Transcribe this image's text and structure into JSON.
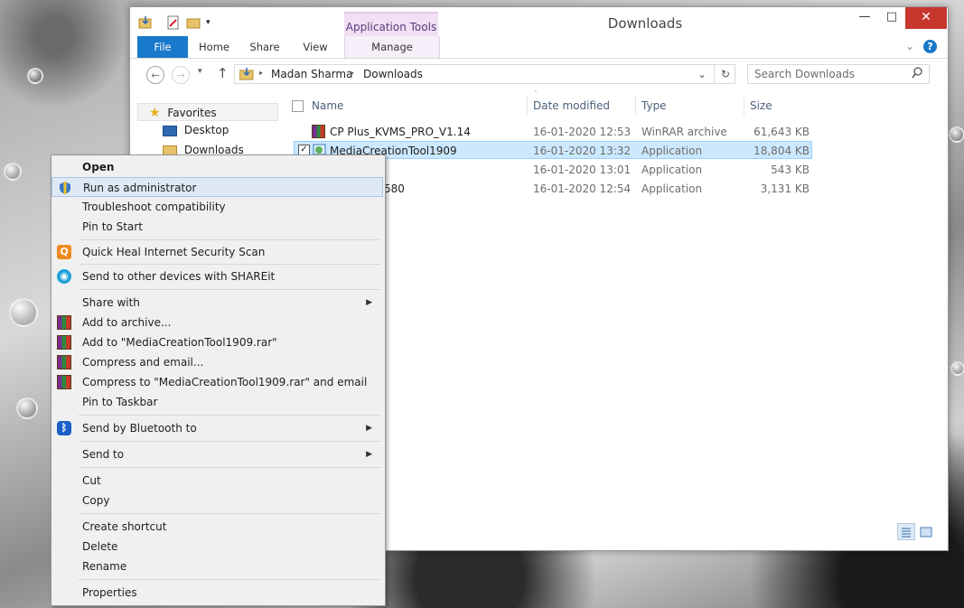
{
  "window": {
    "title": "Downloads",
    "app_tools_label": "Application Tools",
    "minimize": "—",
    "maximize": "□",
    "close": "✕"
  },
  "ribbon": {
    "tabs": [
      "File",
      "Home",
      "Share",
      "View",
      "Manage"
    ],
    "collapse_icon": "chevron-down-icon",
    "help_icon": "help-icon"
  },
  "address": {
    "crumbs": [
      "Madan Sharma",
      "Downloads"
    ],
    "separator": "▸",
    "search_placeholder": "Search Downloads"
  },
  "nav_pane": {
    "items": [
      "Favorites",
      "Desktop",
      "Downloads"
    ]
  },
  "columns": [
    "Name",
    "Date modified",
    "Type",
    "Size"
  ],
  "files": [
    {
      "name": "CP Plus_KVMS_PRO_V1.14",
      "date": "16-01-2020 12:53",
      "type": "WinRAR archive",
      "size": "61,643 KB"
    },
    {
      "name": "MediaCreationTool1909",
      "date": "16-01-2020 13:32",
      "type": "Application",
      "size": "18,804 KB"
    },
    {
      "name": "",
      "date": "16-01-2020 13:01",
      "type": "Application",
      "size": "543 KB"
    },
    {
      "name": "580",
      "date": "16-01-2020 12:54",
      "type": "Application",
      "size": "3,131 KB"
    }
  ],
  "context_menu": {
    "items": [
      "Open",
      "Run as administrator",
      "Troubleshoot compatibility",
      "Pin to Start",
      "Quick Heal Internet Security Scan",
      "Send to other devices with SHAREit",
      "Share with",
      "Add to archive...",
      "Add to \"MediaCreationTool1909.rar\"",
      "Compress and email...",
      "Compress to \"MediaCreationTool1909.rar\" and email",
      "Pin to Taskbar",
      "Send by Bluetooth to",
      "Send to",
      "Cut",
      "Copy",
      "Create shortcut",
      "Delete",
      "Rename",
      "Properties"
    ],
    "submenu_arrow": "▶"
  },
  "colors": {
    "accent": "#1979ca",
    "selection": "#cce8ff",
    "close_button": "#c7372e",
    "app_tools": "#f1dff4"
  }
}
